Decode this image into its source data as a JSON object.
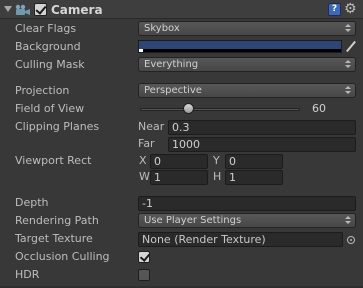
{
  "header": {
    "title": "Camera",
    "help_glyph": "?",
    "settings_glyph": "⚙",
    "enabled": true
  },
  "labels": {
    "clear_flags": "Clear Flags",
    "background": "Background",
    "culling_mask": "Culling Mask",
    "projection": "Projection",
    "field_of_view": "Field of View",
    "clipping_planes": "Clipping Planes",
    "viewport_rect": "Viewport Rect",
    "depth": "Depth",
    "rendering_path": "Rendering Path",
    "target_texture": "Target Texture",
    "occlusion_culling": "Occlusion Culling",
    "hdr": "HDR"
  },
  "values": {
    "clear_flags": "Skybox",
    "background_color": "#2e4578",
    "culling_mask": "Everything",
    "projection": "Perspective",
    "field_of_view": "60",
    "field_of_view_fraction": 0.3,
    "near_label": "Near",
    "near": "0.3",
    "far_label": "Far",
    "far": "1000",
    "x_label": "X",
    "x": "0",
    "y_label": "Y",
    "y": "0",
    "w_label": "W",
    "w": "1",
    "h_label": "H",
    "h": "1",
    "depth": "-1",
    "rendering_path": "Use Player Settings",
    "target_texture": "None (Render Texture)",
    "occlusion_culling": true,
    "hdr": false
  },
  "icons": {
    "camera": "camera-icon",
    "help": "help-icon",
    "settings": "gear-icon",
    "color_picker": "eyedropper-icon",
    "object_picker": "object-picker-icon"
  }
}
